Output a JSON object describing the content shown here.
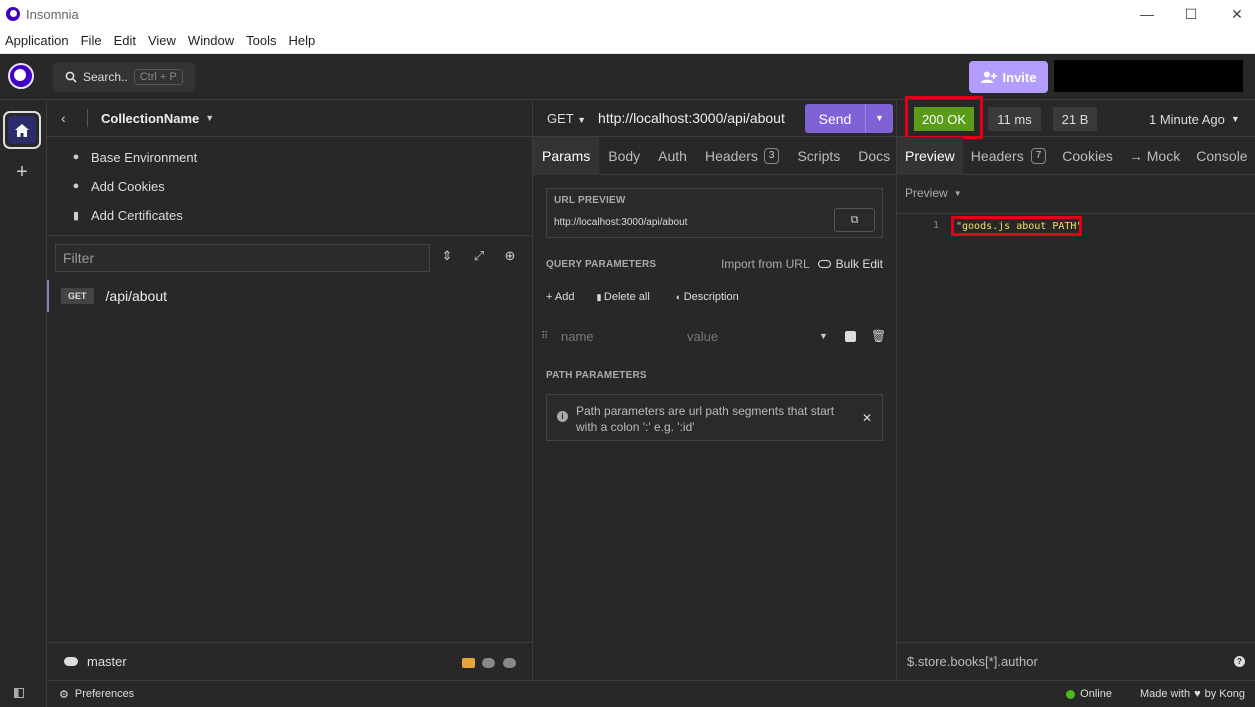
{
  "window": {
    "title": "Insomnia",
    "controls": {
      "minimize": "—",
      "maximize": "☐",
      "close": "✕"
    }
  },
  "menubar": [
    "Application",
    "File",
    "Edit",
    "View",
    "Window",
    "Tools",
    "Help"
  ],
  "header": {
    "search_label": "Search..",
    "search_shortcut": "Ctrl + P",
    "invite_label": "Invite"
  },
  "sidebar": {
    "collection_name": "CollectionName",
    "links": [
      {
        "label": "Base Environment",
        "icon": "globe-icon"
      },
      {
        "label": "Add Cookies",
        "icon": "cookie-icon"
      },
      {
        "label": "Add Certificates",
        "icon": "certificate-icon"
      }
    ],
    "filter_placeholder": "Filter",
    "requests": [
      {
        "method": "GET",
        "path": "/api/about"
      }
    ],
    "branch": "master"
  },
  "request": {
    "method": "GET",
    "url": "http://localhost:3000/api/about",
    "send_label": "Send",
    "tabs": [
      {
        "label": "Params",
        "active": true
      },
      {
        "label": "Body"
      },
      {
        "label": "Auth"
      },
      {
        "label": "Headers",
        "count": "3"
      },
      {
        "label": "Scripts"
      },
      {
        "label": "Docs"
      }
    ],
    "url_preview_label": "URL PREVIEW",
    "url_preview_value": "http://localhost:3000/api/about",
    "query_params_label": "QUERY PARAMETERS",
    "import_from_url": "Import from URL",
    "bulk_edit": "Bulk Edit",
    "add_label": "Add",
    "delete_all_label": "Delete all",
    "description_label": "Description",
    "param_name_placeholder": "name",
    "param_value_placeholder": "value",
    "path_params_label": "PATH PARAMETERS",
    "path_params_info_line1": "Path parameters are url path segments that start",
    "path_params_info_line2": "with a colon ':' e.g. ':id'"
  },
  "response": {
    "status": "200 OK",
    "status_color": "#5a9b18",
    "time": "11 ms",
    "size": "21 B",
    "ago": "1 Minute Ago",
    "tabs": [
      {
        "label": "Preview",
        "active": true
      },
      {
        "label": "Headers",
        "count": "7"
      },
      {
        "label": "Cookies"
      },
      {
        "label": "→ Mock"
      },
      {
        "label": "Console"
      }
    ],
    "preview_mode": "Preview",
    "line_number": "1",
    "body": "\"goods.js about PATH\"",
    "jsonpath_placeholder": "$.store.books[*].author"
  },
  "footer": {
    "preferences": "Preferences",
    "online": "Online",
    "made_with": "Made with",
    "by_kong": "by Kong"
  }
}
